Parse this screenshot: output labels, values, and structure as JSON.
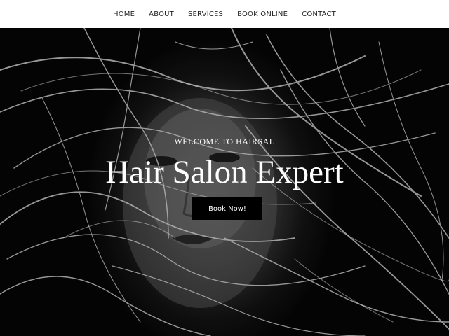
{
  "nav": {
    "items": [
      {
        "label": "HOME"
      },
      {
        "label": "ABOUT"
      },
      {
        "label": "SERVICES"
      },
      {
        "label": "BOOK ONLINE"
      },
      {
        "label": "CONTACT"
      }
    ]
  },
  "hero": {
    "welcome": "WELCOME TO HAIRSAL",
    "headline": "Hair Salon Expert",
    "cta_label": "Book Now!",
    "image_icon": "woman-flowing-hair-photo"
  },
  "colors": {
    "header_bg": "#ffffff",
    "nav_text": "#222222",
    "hero_text": "#ffffff",
    "button_bg": "#000000",
    "button_text": "#ffffff"
  }
}
